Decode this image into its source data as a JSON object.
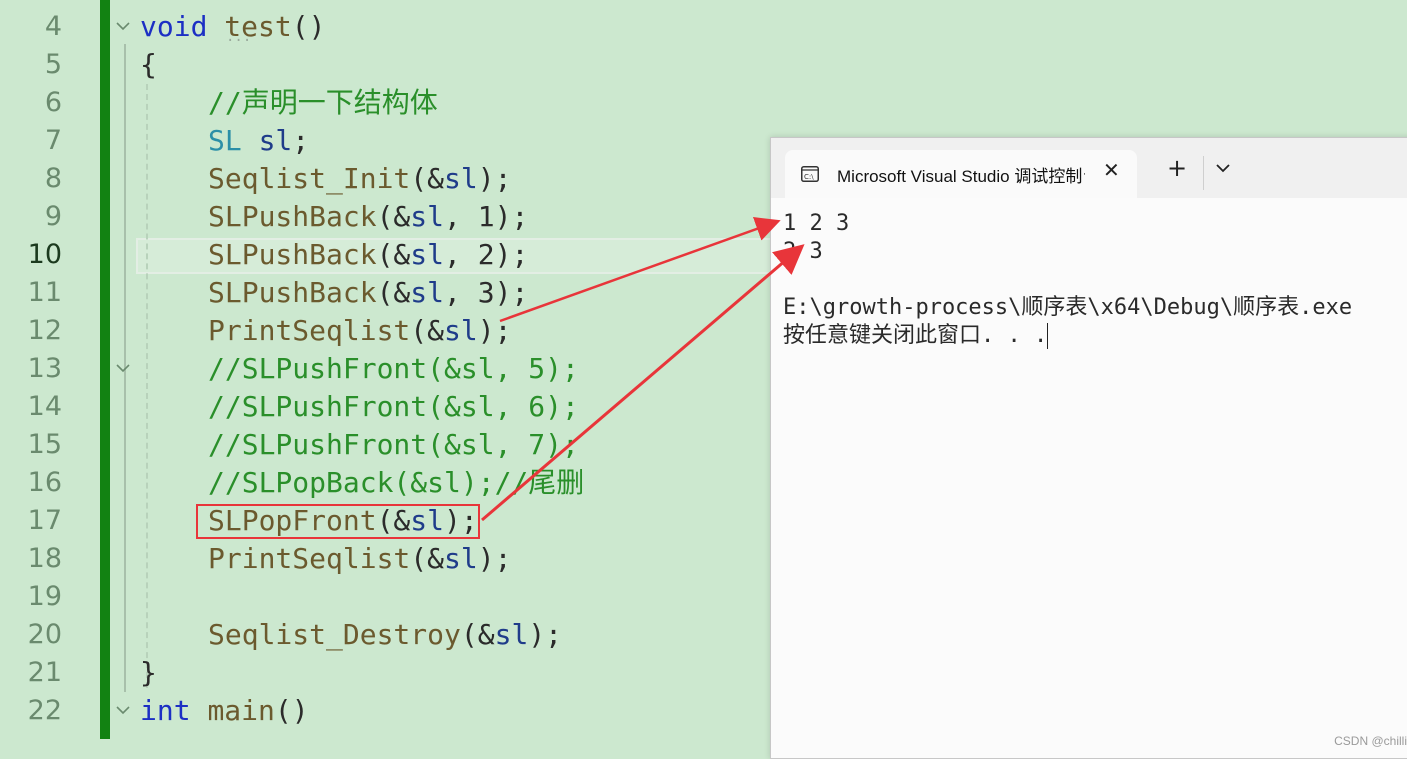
{
  "editor": {
    "lines": [
      {
        "num": "4",
        "tokens": [
          [
            "kw",
            "void "
          ],
          [
            "fn",
            "test"
          ],
          [
            "pl",
            "()"
          ]
        ]
      },
      {
        "num": "5",
        "tokens": [
          [
            "pl",
            "{"
          ]
        ]
      },
      {
        "num": "6",
        "tokens": [
          [
            "cm",
            "//声明一下结构体"
          ]
        ]
      },
      {
        "num": "7",
        "tokens": [
          [
            "ty",
            "SL "
          ],
          [
            "vr",
            "sl"
          ],
          [
            "pl",
            ";"
          ]
        ]
      },
      {
        "num": "8",
        "tokens": [
          [
            "fn",
            "Seqlist_Init"
          ],
          [
            "pl",
            "(&"
          ],
          [
            "vr",
            "sl"
          ],
          [
            "pl",
            ");"
          ]
        ]
      },
      {
        "num": "9",
        "tokens": [
          [
            "fn",
            "SLPushBack"
          ],
          [
            "pl",
            "(&"
          ],
          [
            "vr",
            "sl"
          ],
          [
            "pl",
            ", 1);"
          ]
        ]
      },
      {
        "num": "10",
        "tokens": [
          [
            "fn",
            "SLPushBack"
          ],
          [
            "pl",
            "(&"
          ],
          [
            "vr",
            "sl"
          ],
          [
            "pl",
            ", 2);"
          ]
        ]
      },
      {
        "num": "11",
        "tokens": [
          [
            "fn",
            "SLPushBack"
          ],
          [
            "pl",
            "(&"
          ],
          [
            "vr",
            "sl"
          ],
          [
            "pl",
            ", 3);"
          ]
        ]
      },
      {
        "num": "12",
        "tokens": [
          [
            "fn",
            "PrintSeqlist"
          ],
          [
            "pl",
            "(&"
          ],
          [
            "vr",
            "sl"
          ],
          [
            "pl",
            ");"
          ]
        ]
      },
      {
        "num": "13",
        "tokens": [
          [
            "cm",
            "//SLPushFront(&sl, 5);"
          ]
        ]
      },
      {
        "num": "14",
        "tokens": [
          [
            "cm",
            "//SLPushFront(&sl, 6);"
          ]
        ]
      },
      {
        "num": "15",
        "tokens": [
          [
            "cm",
            "//SLPushFront(&sl, 7);"
          ]
        ]
      },
      {
        "num": "16",
        "tokens": [
          [
            "cm",
            "//SLPopBack(&sl);//尾删"
          ]
        ]
      },
      {
        "num": "17",
        "tokens": [
          [
            "fn",
            "SLPopFront"
          ],
          [
            "pl",
            "(&"
          ],
          [
            "vr",
            "sl"
          ],
          [
            "pl",
            ");"
          ]
        ]
      },
      {
        "num": "18",
        "tokens": [
          [
            "fn",
            "PrintSeqlist"
          ],
          [
            "pl",
            "(&"
          ],
          [
            "vr",
            "sl"
          ],
          [
            "pl",
            ");"
          ]
        ]
      },
      {
        "num": "19",
        "tokens": []
      },
      {
        "num": "20",
        "tokens": [
          [
            "fn",
            "Seqlist_Destroy"
          ],
          [
            "pl",
            "(&"
          ],
          [
            "vr",
            "sl"
          ],
          [
            "pl",
            ");"
          ]
        ]
      },
      {
        "num": "21",
        "tokens": [
          [
            "pl",
            "}"
          ]
        ]
      },
      {
        "num": "22",
        "tokens": [
          [
            "kw",
            "int "
          ],
          [
            "fn",
            "main"
          ],
          [
            "pl",
            "()"
          ]
        ]
      }
    ],
    "current_line": "10",
    "highlighted_line": "17"
  },
  "console": {
    "tab_title": "Microsoft Visual Studio 调试控制台",
    "new_tab_label": "+",
    "close_label": "✕",
    "output_lines": [
      "1 2 3",
      "2 3",
      "",
      "E:\\growth-process\\顺序表\\x64\\Debug\\顺序表.exe",
      "按任意键关闭此窗口. . ."
    ]
  },
  "watermark": "CSDN @chilli q",
  "colors": {
    "gutter": "#128212",
    "arrow": "#e8353a",
    "editor_bg": "#cce8cf"
  }
}
